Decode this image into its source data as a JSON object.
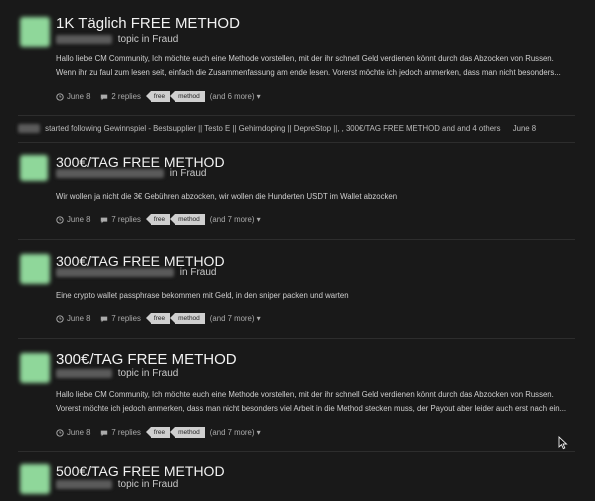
{
  "posts": [
    {
      "title": "1K Täglich FREE METHOD",
      "meta": "topic in Fraud",
      "excerpt": "Hallo liebe CM Community, Ich möchte euch eine Methode vorstellen, mit der ihr schnell Geld verdienen könnt durch das Abzocken von Russen. Wenn ihr zu faul zum lesen seit, einfach die Zusammenfassung am ende lesen. Vorerst möchte ich jedoch anmerken, dass man nicht besonders...",
      "date": "June 8",
      "replies": "2 replies",
      "tags": [
        "free",
        "method"
      ],
      "more": "(and 6 more)"
    },
    {
      "title": "300€/TAG FREE METHOD",
      "meta": "in Fraud",
      "excerpt": "Wir wollen ja nicht die 3€ Gebühren abzocken, wir wollen die Hunderten USDT im Wallet abzocken",
      "date": "June 8",
      "replies": "7 replies",
      "tags": [
        "free",
        "method"
      ],
      "more": "(and 7 more)"
    },
    {
      "title": "300€/TAG FREE METHOD",
      "meta": "in Fraud",
      "excerpt": "Eine crypto wallet passphrase bekommen mit Geld, in den sniper packen und warten",
      "date": "June 8",
      "replies": "7 replies",
      "tags": [
        "free",
        "method"
      ],
      "more": "(and 7 more)"
    },
    {
      "title": "300€/TAG FREE METHOD",
      "meta": "topic in Fraud",
      "excerpt": "Hallo liebe CM Community, Ich möchte euch eine Methode vorstellen, mit der ihr schnell Geld verdienen könnt durch das Abzocken von Russen. Vorerst möchte ich jedoch anmerken, dass man nicht besonders viel Arbeit in die Method stecken muss, der Payout aber leider auch erst nach ein...",
      "date": "June 8",
      "replies": "7 replies",
      "tags": [
        "free",
        "method"
      ],
      "more": "(and 7 more)"
    },
    {
      "title": "500€/TAG FREE METHOD",
      "meta": "topic in Fraud"
    }
  ],
  "activity": {
    "text": "started following Gewinnspiel - Bestsupplier || Testo E || Gehirndoping || DepreStop ||, , 300€/TAG FREE METHOD and and 4 others",
    "date": "June 8"
  },
  "colors": {
    "background": "#191919",
    "avatar": "#8fd79a",
    "tag_bg": "#cfcfcf"
  }
}
